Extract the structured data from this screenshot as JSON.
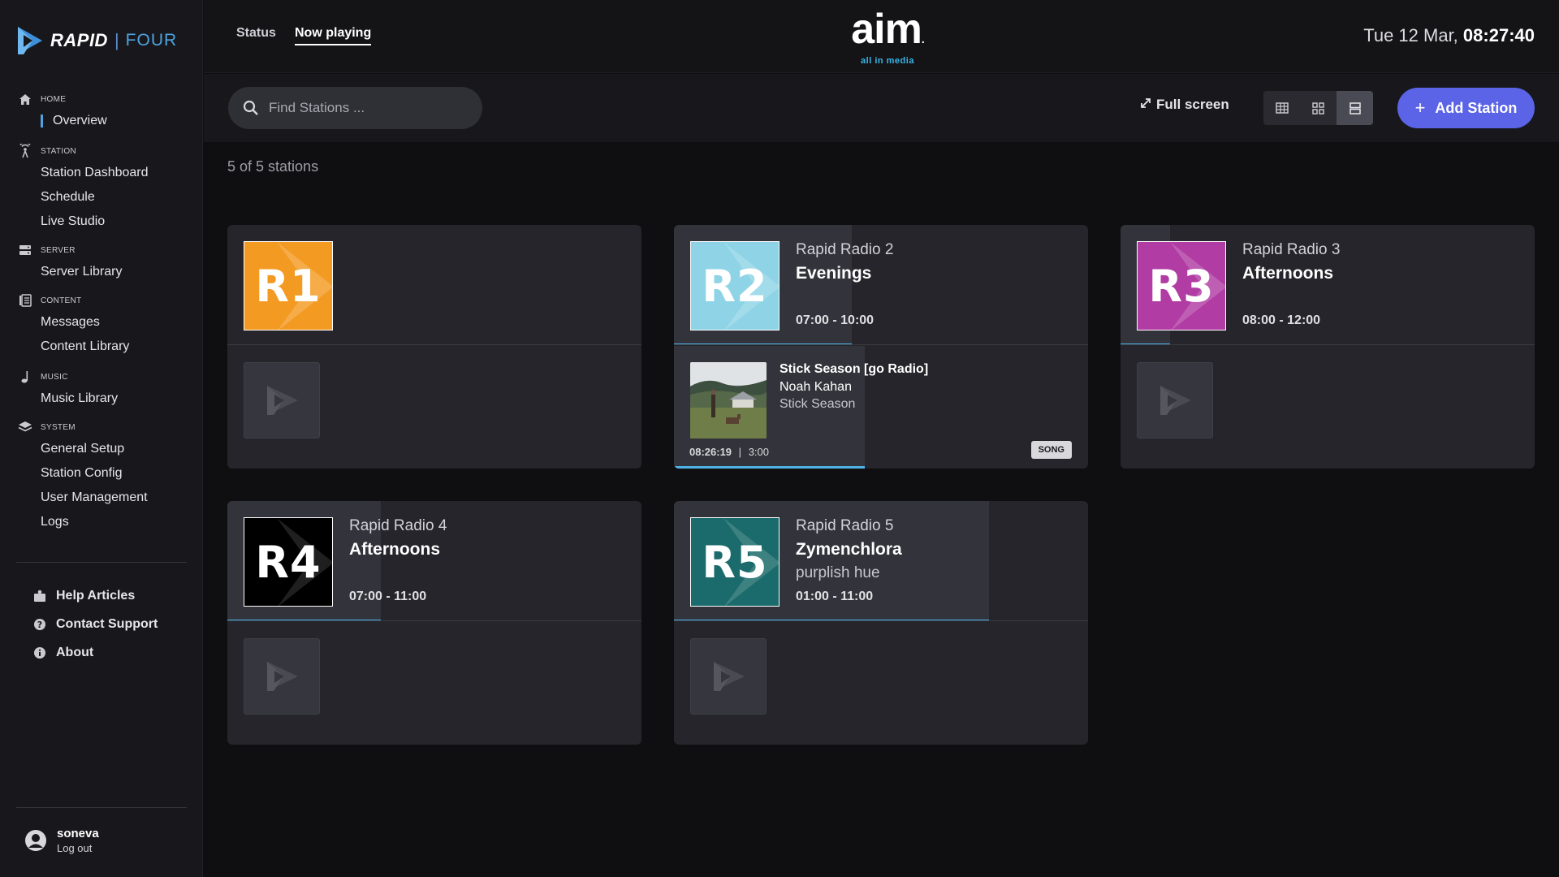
{
  "brand": {
    "name": "RAPID",
    "separator": "|",
    "edition": "FOUR",
    "accent": "#4fa3e0"
  },
  "sidebar": {
    "sections": [
      {
        "label": "HOME",
        "icon": "home-icon",
        "items": [
          {
            "label": "Overview",
            "active": true
          }
        ]
      },
      {
        "label": "STATION",
        "icon": "broadcast-tower-icon",
        "items": [
          {
            "label": "Station Dashboard"
          },
          {
            "label": "Schedule"
          },
          {
            "label": "Live Studio"
          }
        ]
      },
      {
        "label": "SERVER",
        "icon": "server-icon",
        "items": [
          {
            "label": "Server Library"
          }
        ]
      },
      {
        "label": "CONTENT",
        "icon": "content-list-icon",
        "items": [
          {
            "label": "Messages"
          },
          {
            "label": "Content Library"
          }
        ]
      },
      {
        "label": "MUSIC",
        "icon": "music-note-icon",
        "items": [
          {
            "label": "Music Library"
          }
        ]
      },
      {
        "label": "SYSTEM",
        "icon": "layers-icon",
        "items": [
          {
            "label": "General Setup"
          },
          {
            "label": "Station Config"
          },
          {
            "label": "User Management"
          },
          {
            "label": "Logs"
          }
        ]
      }
    ],
    "help": [
      {
        "label": "Help Articles",
        "icon": "help-articles-icon"
      },
      {
        "label": "Contact Support",
        "icon": "support-icon"
      },
      {
        "label": "About",
        "icon": "info-icon"
      }
    ],
    "user": {
      "name": "soneva",
      "logout": "Log out"
    }
  },
  "header": {
    "tabs": [
      {
        "label": "Status",
        "active": false
      },
      {
        "label": "Now playing",
        "active": true
      }
    ],
    "aim_logo": {
      "word": "aim",
      "tagline": "all in media",
      "trademark": "."
    },
    "clock": {
      "date": "Tue 12 Mar,",
      "time": "08:27:40"
    }
  },
  "toolbar": {
    "search_placeholder": "Find Stations ...",
    "fullscreen_label": "Full screen",
    "add_station_label": "Add Station",
    "add_plus": "+",
    "active_view": "list"
  },
  "content": {
    "count_text": "5 of 5 stations"
  },
  "stations": [
    {
      "tile": "R1",
      "color": "#f39a22",
      "name": "",
      "show": "",
      "sub": "",
      "time": "",
      "show_progress": 0,
      "now_playing": null
    },
    {
      "tile": "R2",
      "color": "#8ed4e6",
      "name": "Rapid Radio 2",
      "show": "Evenings",
      "sub": "",
      "time": "07:00 - 10:00",
      "show_progress": 0.43,
      "now_playing": {
        "title": "Stick Season [go Radio]",
        "artist": "Noah Kahan",
        "album": "Stick Season",
        "start": "08:26:19",
        "divider": "|",
        "duration": "3:00",
        "badge": "SONG",
        "progress": 0.46
      }
    },
    {
      "tile": "R3",
      "color": "#b13ca4",
      "name": "Rapid Radio 3",
      "show": "Afternoons",
      "sub": "",
      "time": "08:00 - 12:00",
      "show_progress": 0.12,
      "now_playing": null
    },
    {
      "tile": "R4",
      "color": "#000000",
      "name": "Rapid Radio 4",
      "show": "Afternoons",
      "sub": "",
      "time": "07:00 - 11:00",
      "show_progress": 0.37,
      "now_playing": null
    },
    {
      "tile": "R5",
      "color": "#1c6b6c",
      "name": "Rapid Radio 5",
      "show": "Zymenchlora",
      "sub": "purplish hue",
      "time": "01:00 - 11:00",
      "show_progress": 0.76,
      "now_playing": null
    }
  ]
}
